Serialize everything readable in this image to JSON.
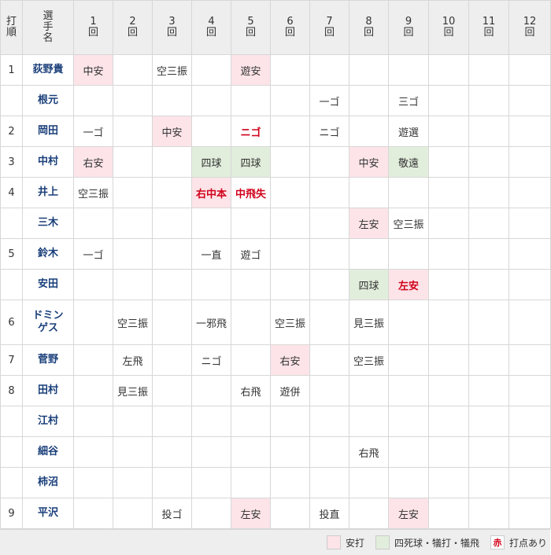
{
  "header": {
    "order": "打\n順",
    "player": "選\n手\n名",
    "innings": [
      "1\n回",
      "2\n回",
      "3\n回",
      "4\n回",
      "5\n回",
      "6\n回",
      "7\n回",
      "8\n回",
      "9\n回",
      "10\n回",
      "11\n回",
      "12\n回"
    ]
  },
  "rows": [
    {
      "order": "1",
      "player": "荻野貴",
      "cells": [
        [
          "中安",
          "hit",
          false
        ],
        [
          "",
          "",
          false
        ],
        [
          "空三振",
          "",
          false
        ],
        [
          "",
          "",
          false
        ],
        [
          "遊安",
          "hit",
          false
        ],
        [
          "",
          "",
          false
        ],
        [
          "",
          "",
          false
        ],
        [
          "",
          "",
          false
        ],
        [
          "",
          "",
          false
        ],
        [
          "",
          "",
          false
        ],
        [
          "",
          "",
          false
        ],
        [
          "",
          "",
          false
        ]
      ]
    },
    {
      "order": "",
      "player": "根元",
      "cells": [
        [
          "",
          "",
          false
        ],
        [
          "",
          "",
          false
        ],
        [
          "",
          "",
          false
        ],
        [
          "",
          "",
          false
        ],
        [
          "",
          "",
          false
        ],
        [
          "",
          "",
          false
        ],
        [
          "一ゴ",
          "",
          false
        ],
        [
          "",
          "",
          false
        ],
        [
          "三ゴ",
          "",
          false
        ],
        [
          "",
          "",
          false
        ],
        [
          "",
          "",
          false
        ],
        [
          "",
          "",
          false
        ]
      ]
    },
    {
      "order": "2",
      "player": "岡田",
      "cells": [
        [
          "一ゴ",
          "",
          false
        ],
        [
          "",
          "",
          false
        ],
        [
          "中安",
          "hit",
          false
        ],
        [
          "",
          "",
          false
        ],
        [
          "ニゴ",
          "",
          true
        ],
        [
          "",
          "",
          false
        ],
        [
          "ニゴ",
          "",
          false
        ],
        [
          "",
          "",
          false
        ],
        [
          "遊選",
          "",
          false
        ],
        [
          "",
          "",
          false
        ],
        [
          "",
          "",
          false
        ],
        [
          "",
          "",
          false
        ]
      ]
    },
    {
      "order": "3",
      "player": "中村",
      "cells": [
        [
          "右安",
          "hit",
          false
        ],
        [
          "",
          "",
          false
        ],
        [
          "",
          "",
          false
        ],
        [
          "四球",
          "walk",
          false
        ],
        [
          "四球",
          "walk",
          false
        ],
        [
          "",
          "",
          false
        ],
        [
          "",
          "",
          false
        ],
        [
          "中安",
          "hit",
          false
        ],
        [
          "敬遠",
          "walk",
          false
        ],
        [
          "",
          "",
          false
        ],
        [
          "",
          "",
          false
        ],
        [
          "",
          "",
          false
        ]
      ]
    },
    {
      "order": "4",
      "player": "井上",
      "cells": [
        [
          "空三振",
          "",
          false
        ],
        [
          "",
          "",
          false
        ],
        [
          "",
          "",
          false
        ],
        [
          "右中本",
          "hit",
          true
        ],
        [
          "中飛失",
          "",
          true
        ],
        [
          "",
          "",
          false
        ],
        [
          "",
          "",
          false
        ],
        [
          "",
          "",
          false
        ],
        [
          "",
          "",
          false
        ],
        [
          "",
          "",
          false
        ],
        [
          "",
          "",
          false
        ],
        [
          "",
          "",
          false
        ]
      ]
    },
    {
      "order": "",
      "player": "三木",
      "cells": [
        [
          "",
          "",
          false
        ],
        [
          "",
          "",
          false
        ],
        [
          "",
          "",
          false
        ],
        [
          "",
          "",
          false
        ],
        [
          "",
          "",
          false
        ],
        [
          "",
          "",
          false
        ],
        [
          "",
          "",
          false
        ],
        [
          "左安",
          "hit",
          false
        ],
        [
          "空三振",
          "",
          false
        ],
        [
          "",
          "",
          false
        ],
        [
          "",
          "",
          false
        ],
        [
          "",
          "",
          false
        ]
      ]
    },
    {
      "order": "5",
      "player": "鈴木",
      "cells": [
        [
          "一ゴ",
          "",
          false
        ],
        [
          "",
          "",
          false
        ],
        [
          "",
          "",
          false
        ],
        [
          "一直",
          "",
          false
        ],
        [
          "遊ゴ",
          "",
          false
        ],
        [
          "",
          "",
          false
        ],
        [
          "",
          "",
          false
        ],
        [
          "",
          "",
          false
        ],
        [
          "",
          "",
          false
        ],
        [
          "",
          "",
          false
        ],
        [
          "",
          "",
          false
        ],
        [
          "",
          "",
          false
        ]
      ]
    },
    {
      "order": "",
      "player": "安田",
      "cells": [
        [
          "",
          "",
          false
        ],
        [
          "",
          "",
          false
        ],
        [
          "",
          "",
          false
        ],
        [
          "",
          "",
          false
        ],
        [
          "",
          "",
          false
        ],
        [
          "",
          "",
          false
        ],
        [
          "",
          "",
          false
        ],
        [
          "四球",
          "walk",
          false
        ],
        [
          "左安",
          "hit",
          true
        ],
        [
          "",
          "",
          false
        ],
        [
          "",
          "",
          false
        ],
        [
          "",
          "",
          false
        ]
      ]
    },
    {
      "order": "6",
      "player": "ドミン\nゲス",
      "tall": true,
      "cells": [
        [
          "",
          "",
          false
        ],
        [
          "空三振",
          "",
          false
        ],
        [
          "",
          "",
          false
        ],
        [
          "一邪飛",
          "",
          false
        ],
        [
          "",
          "",
          false
        ],
        [
          "空三振",
          "",
          false
        ],
        [
          "",
          "",
          false
        ],
        [
          "見三振",
          "",
          false
        ],
        [
          "",
          "",
          false
        ],
        [
          "",
          "",
          false
        ],
        [
          "",
          "",
          false
        ],
        [
          "",
          "",
          false
        ]
      ]
    },
    {
      "order": "7",
      "player": "菅野",
      "cells": [
        [
          "",
          "",
          false
        ],
        [
          "左飛",
          "",
          false
        ],
        [
          "",
          "",
          false
        ],
        [
          "ニゴ",
          "",
          false
        ],
        [
          "",
          "",
          false
        ],
        [
          "右安",
          "hit",
          false
        ],
        [
          "",
          "",
          false
        ],
        [
          "空三振",
          "",
          false
        ],
        [
          "",
          "",
          false
        ],
        [
          "",
          "",
          false
        ],
        [
          "",
          "",
          false
        ],
        [
          "",
          "",
          false
        ]
      ]
    },
    {
      "order": "8",
      "player": "田村",
      "cells": [
        [
          "",
          "",
          false
        ],
        [
          "見三振",
          "",
          false
        ],
        [
          "",
          "",
          false
        ],
        [
          "",
          "",
          false
        ],
        [
          "右飛",
          "",
          false
        ],
        [
          "遊併",
          "",
          false
        ],
        [
          "",
          "",
          false
        ],
        [
          "",
          "",
          false
        ],
        [
          "",
          "",
          false
        ],
        [
          "",
          "",
          false
        ],
        [
          "",
          "",
          false
        ],
        [
          "",
          "",
          false
        ]
      ]
    },
    {
      "order": "",
      "player": "江村",
      "cells": [
        [
          "",
          "",
          false
        ],
        [
          "",
          "",
          false
        ],
        [
          "",
          "",
          false
        ],
        [
          "",
          "",
          false
        ],
        [
          "",
          "",
          false
        ],
        [
          "",
          "",
          false
        ],
        [
          "",
          "",
          false
        ],
        [
          "",
          "",
          false
        ],
        [
          "",
          "",
          false
        ],
        [
          "",
          "",
          false
        ],
        [
          "",
          "",
          false
        ],
        [
          "",
          "",
          false
        ]
      ]
    },
    {
      "order": "",
      "player": "細谷",
      "cells": [
        [
          "",
          "",
          false
        ],
        [
          "",
          "",
          false
        ],
        [
          "",
          "",
          false
        ],
        [
          "",
          "",
          false
        ],
        [
          "",
          "",
          false
        ],
        [
          "",
          "",
          false
        ],
        [
          "",
          "",
          false
        ],
        [
          "右飛",
          "",
          false
        ],
        [
          "",
          "",
          false
        ],
        [
          "",
          "",
          false
        ],
        [
          "",
          "",
          false
        ],
        [
          "",
          "",
          false
        ]
      ]
    },
    {
      "order": "",
      "player": "柿沼",
      "cells": [
        [
          "",
          "",
          false
        ],
        [
          "",
          "",
          false
        ],
        [
          "",
          "",
          false
        ],
        [
          "",
          "",
          false
        ],
        [
          "",
          "",
          false
        ],
        [
          "",
          "",
          false
        ],
        [
          "",
          "",
          false
        ],
        [
          "",
          "",
          false
        ],
        [
          "",
          "",
          false
        ],
        [
          "",
          "",
          false
        ],
        [
          "",
          "",
          false
        ],
        [
          "",
          "",
          false
        ]
      ]
    },
    {
      "order": "9",
      "player": "平沢",
      "cells": [
        [
          "",
          "",
          false
        ],
        [
          "",
          "",
          false
        ],
        [
          "投ゴ",
          "",
          false
        ],
        [
          "",
          "",
          false
        ],
        [
          "左安",
          "hit",
          false
        ],
        [
          "",
          "",
          false
        ],
        [
          "投直",
          "",
          false
        ],
        [
          "",
          "",
          false
        ],
        [
          "左安",
          "hit",
          false
        ],
        [
          "",
          "",
          false
        ],
        [
          "",
          "",
          false
        ],
        [
          "",
          "",
          false
        ]
      ]
    }
  ],
  "legend": {
    "hit_label": "安打",
    "walk_label": "四死球・犠打・犠飛",
    "rbi_mark": "赤",
    "rbi_label": "打点あり",
    "colors": {
      "hit": "#fce4e8",
      "walk": "#e2eedc",
      "rbi": "#d0021b"
    }
  }
}
